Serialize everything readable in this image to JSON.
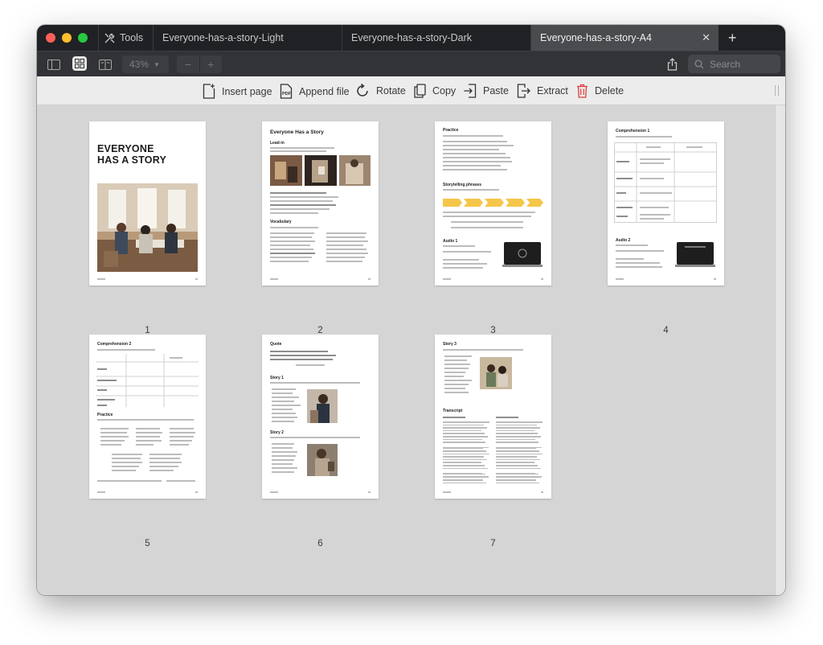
{
  "window": {
    "tools_label": "Tools",
    "tabs": [
      {
        "label": "Everyone-has-a-story-Light",
        "active": false
      },
      {
        "label": "Everyone-has-a-story-Dark",
        "active": false
      },
      {
        "label": "Everyone-has-a-story-A4",
        "active": true
      }
    ],
    "new_tab": "+",
    "close": "✕"
  },
  "toolbar": {
    "zoom": "43%",
    "zoom_out": "−",
    "zoom_in": "+",
    "search_placeholder": "Search"
  },
  "actions": {
    "insert_page": "Insert page",
    "append_file": "Append file",
    "rotate": "Rotate",
    "copy": "Copy",
    "paste": "Paste",
    "extract": "Extract",
    "delete": "Delete"
  },
  "pages": [
    {
      "number": "1",
      "title_line1": "EVERYONE",
      "title_line2": "HAS A STORY"
    },
    {
      "number": "2",
      "heading": "Everyone Has a Story",
      "section1": "Lead-in",
      "section2": "Vocabulary"
    },
    {
      "number": "3",
      "heading": "Practice",
      "section1": "Storytelling phrases",
      "section2": "Audio 1"
    },
    {
      "number": "4",
      "heading": "Comprehension 1",
      "section2": "Audio 2"
    },
    {
      "number": "5",
      "heading": "Comprehension 2",
      "section2": "Practice"
    },
    {
      "number": "6",
      "heading": "Quote",
      "section1": "Story 1",
      "section2": "Story 2"
    },
    {
      "number": "7",
      "heading": "Story 3",
      "section2": "Transcript"
    }
  ],
  "colors": {
    "tabbar": "#202124",
    "toolbar": "#323336",
    "actions_bar": "#ececec",
    "canvas": "#d5d5d5",
    "delete_icon": "#e0393e",
    "phrase_arrows": "#f5c64a"
  }
}
